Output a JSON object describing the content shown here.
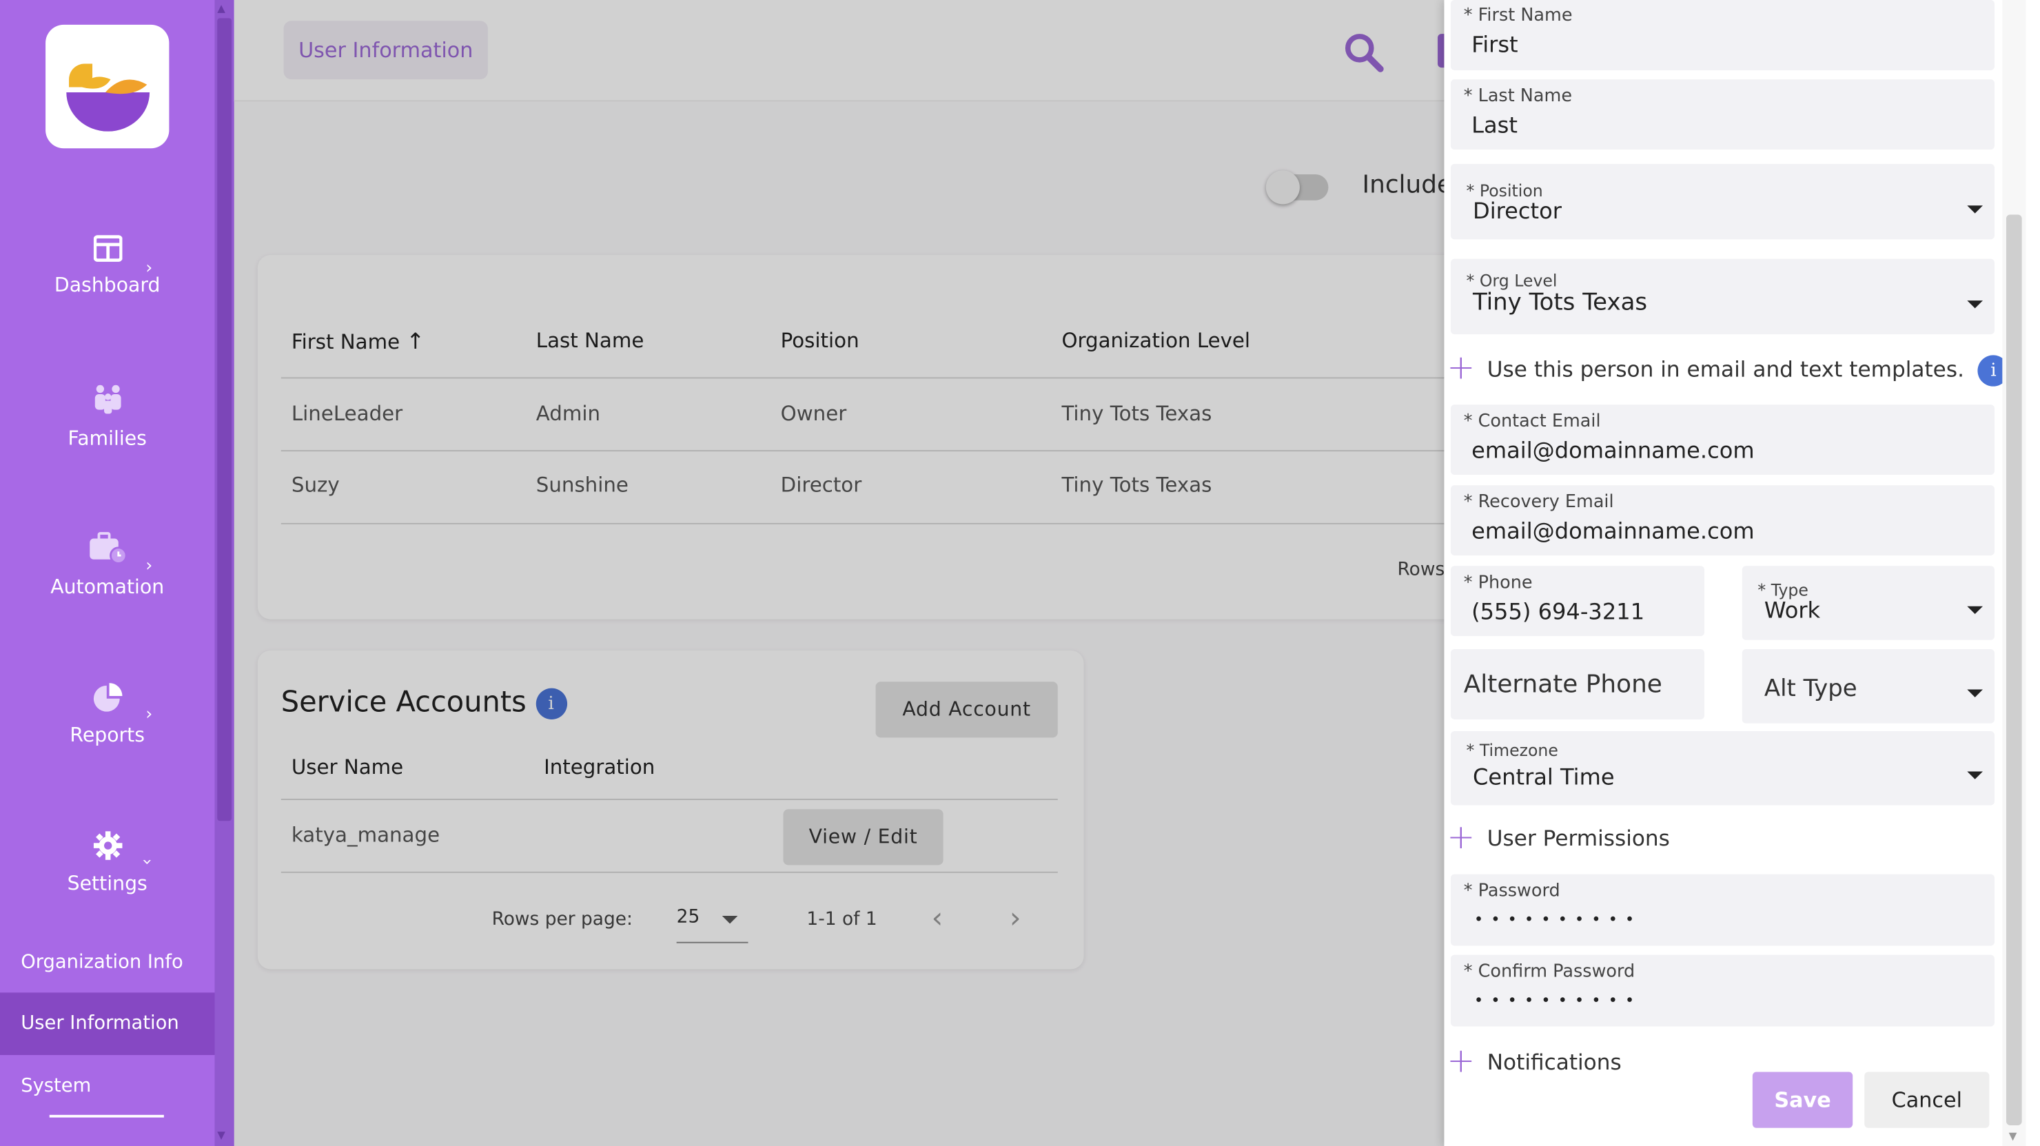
{
  "sidebar": {
    "nav": [
      {
        "label": "Dashboard",
        "icon": "dashboard-icon"
      },
      {
        "label": "Families",
        "icon": "families-icon"
      },
      {
        "label": "Automation",
        "icon": "automation-icon"
      },
      {
        "label": "Reports",
        "icon": "reports-icon"
      },
      {
        "label": "Settings",
        "icon": "gear-icon"
      }
    ],
    "sub": [
      "Organization Info",
      "User Information",
      "System"
    ]
  },
  "header": {
    "breadcrumb": "User Information"
  },
  "toolbar": {
    "include_label": "Include"
  },
  "users_table": {
    "headers": [
      "First Name",
      "Last Name",
      "Position",
      "Organization Level"
    ],
    "sort_arrow": "↑",
    "rows": [
      [
        "LineLeader",
        "Admin",
        "Owner",
        "Tiny Tots Texas"
      ],
      [
        "Suzy",
        "Sunshine",
        "Director",
        "Tiny Tots Texas"
      ]
    ],
    "rows_label": "Rows"
  },
  "service_accounts": {
    "title": "Service Accounts",
    "add_button": "Add Account",
    "headers": [
      "User Name",
      "Integration"
    ],
    "rows": [
      [
        "katya_manage"
      ]
    ],
    "edit_button": "View / Edit",
    "rows_per_page_label": "Rows per page:",
    "rows_per_page": "25",
    "range": "1-1 of 1"
  },
  "form": {
    "first_name": {
      "label": "* First Name",
      "value": "First"
    },
    "last_name": {
      "label": "* Last Name",
      "value": "Last"
    },
    "position": {
      "label": "* Position",
      "value": "Director"
    },
    "org_level": {
      "label": "* Org Level",
      "value": "Tiny Tots Texas"
    },
    "templates_toggle": "Use this person in email and text templates.",
    "contact_email": {
      "label": "* Contact Email",
      "value": "email@domainname.com"
    },
    "recovery_email": {
      "label": "* Recovery Email",
      "value": "email@domainname.com"
    },
    "phone": {
      "label": "* Phone",
      "value": "(555) 694-3211"
    },
    "type": {
      "label": "* Type",
      "value": "Work"
    },
    "alt_phone": {
      "placeholder": "Alternate Phone"
    },
    "alt_type": {
      "placeholder": "Alt Type"
    },
    "timezone": {
      "label": "* Timezone",
      "value": "Central Time"
    },
    "permissions": "User Permissions",
    "password": {
      "label": "* Password",
      "value": "• • • • • • • • • •"
    },
    "confirm_password": {
      "label": "* Confirm Password",
      "value": "• • • • • • • • • •"
    },
    "notifications": "Notifications",
    "save": "Save",
    "cancel": "Cancel"
  },
  "colors": {
    "brand": "#a869e6",
    "accent": "#9b68d6",
    "info": "#4a73d6"
  }
}
